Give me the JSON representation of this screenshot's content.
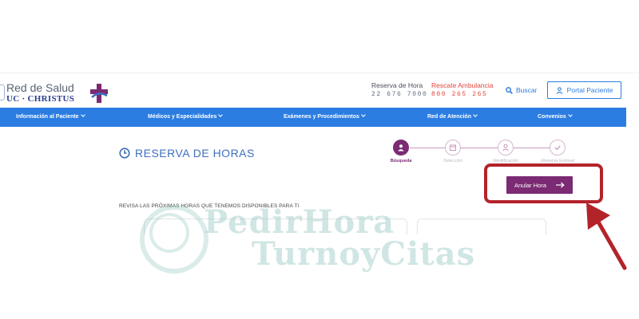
{
  "header": {
    "logo": {
      "line1": "Red de Salud",
      "line2": "UC · CHRISTUS"
    },
    "reserva": {
      "label": "Reserva de Hora",
      "phone": "22 676 7000"
    },
    "rescate": {
      "label": "Rescate Ambulancia",
      "phone": "800 265 265"
    },
    "search_label": "Buscar",
    "portal_label": "Portal Paciente"
  },
  "nav": {
    "items": [
      "Información al Paciente",
      "Médicos y Especialidades",
      "Exámenes y Procedimientos",
      "Red de Atención",
      "Convenios"
    ]
  },
  "main": {
    "title": "RESERVA DE HORAS",
    "steps": [
      {
        "label": "Búsqueda",
        "icon": "user-icon",
        "active": true
      },
      {
        "label": "Selección",
        "icon": "calendar-icon",
        "active": false
      },
      {
        "label": "Identificación",
        "icon": "user-icon",
        "active": false
      },
      {
        "label": "¡Reserva Exitosa!",
        "icon": "check-icon",
        "active": false
      }
    ],
    "cancel_button": "Anular Hora",
    "subtitle": "REVISA LAS PRÓXIMAS HORAS QUE TENEMOS DISPONIBLES PARA TI"
  },
  "watermark": {
    "line1": "PedirHora",
    "line2": "TurnoyCitas"
  },
  "colors": {
    "nav_blue": "#2b7de2",
    "purple": "#7b2a73",
    "highlight_red": "#b3232a",
    "rescate_red": "#e2463c"
  }
}
